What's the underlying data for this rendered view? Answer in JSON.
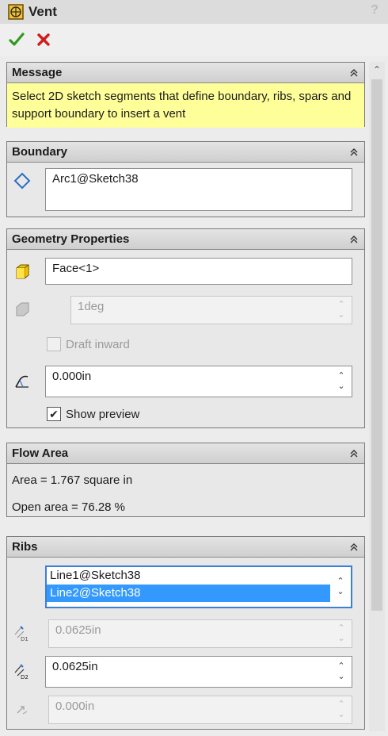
{
  "window": {
    "title": "Vent",
    "help": "?"
  },
  "actions": {
    "ok_icon": "check-icon",
    "cancel_icon": "x-icon"
  },
  "message": {
    "title": "Message",
    "text": "Select 2D sketch segments that define boundary, ribs, spars and support boundary to insert a vent"
  },
  "boundary": {
    "title": "Boundary",
    "value": "Arc1@Sketch38"
  },
  "geometry": {
    "title": "Geometry Properties",
    "face": "Face<1>",
    "draft_angle": "1deg",
    "draft_inward_label": "Draft inward",
    "fillet_radius": "0.000in",
    "show_preview_label": "Show preview",
    "show_preview_checked": true
  },
  "flow": {
    "title": "Flow Area",
    "area": "Area = 1.767 square in",
    "open_area": "Open area = 76.28 %"
  },
  "ribs": {
    "title": "Ribs",
    "items": [
      "Line1@Sketch38",
      "Line2@Sketch38"
    ],
    "selected_index": 1,
    "depth": "0.0625in",
    "width": "0.0625in",
    "offset": "0.000in"
  },
  "colors": {
    "message_bg": "#ffff99",
    "selection": "#3399ff",
    "accent_border": "#3c7fd6"
  }
}
